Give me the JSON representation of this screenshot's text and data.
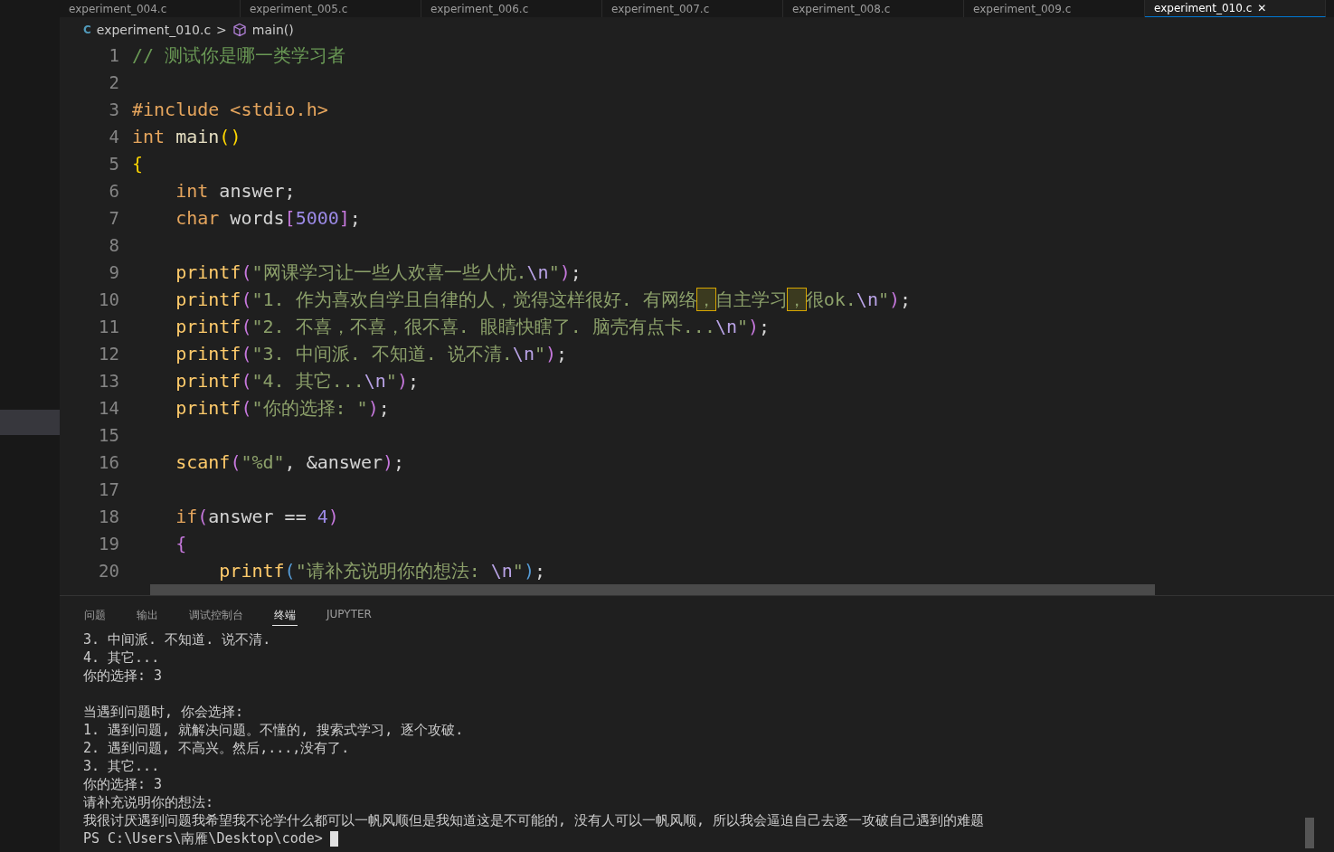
{
  "tabs": [
    {
      "label": "experiment_004.c",
      "selected": false
    },
    {
      "label": "experiment_005.c",
      "selected": false
    },
    {
      "label": "experiment_006.c",
      "selected": false
    },
    {
      "label": "experiment_007.c",
      "selected": false
    },
    {
      "label": "experiment_008.c",
      "selected": false
    },
    {
      "label": "experiment_009.c",
      "selected": false
    },
    {
      "label": "experiment_010.c",
      "selected": true,
      "close": "✕"
    }
  ],
  "breadcrumb": {
    "file_icon": "C",
    "file": "experiment_010.c",
    "separator": ">",
    "symbol": "main()"
  },
  "code_lines": [
    {
      "number": "1",
      "tokens": [
        {
          "kind": "comment",
          "text": "// 测试你是哪一类学习者"
        }
      ]
    },
    {
      "number": "2"
    },
    {
      "number": "3",
      "tokens": [
        {
          "kind": "pre",
          "text": "#include <stdio.h>"
        }
      ]
    },
    {
      "number": "4",
      "tokens": [
        {
          "kind": "type",
          "text": "int"
        },
        {
          "kind": "name",
          "text": " main"
        },
        {
          "kind": "brace",
          "text": "()"
        }
      ]
    },
    {
      "number": "5",
      "tokens": [
        {
          "kind": "brace",
          "text": "{"
        }
      ]
    },
    {
      "number": "6",
      "tokens": [
        {
          "kind": "type",
          "text": "    int"
        },
        {
          "kind": "plain",
          "text": " answer;"
        }
      ]
    },
    {
      "number": "7",
      "tokens": [
        {
          "kind": "type",
          "text": "    char"
        },
        {
          "kind": "plain",
          "text": " words"
        },
        {
          "kind": "paren",
          "text": "["
        },
        {
          "kind": "num",
          "text": "5000"
        },
        {
          "kind": "paren",
          "text": "]"
        },
        {
          "kind": "plain",
          "text": ";"
        }
      ]
    },
    {
      "number": "8"
    },
    {
      "number": "9",
      "tokens": [
        {
          "kind": "func",
          "text": "    printf"
        },
        {
          "kind": "paren",
          "text": "("
        },
        {
          "kind": "string",
          "text": "\"网课学习让一些人欢喜一些人忧."
        },
        {
          "kind": "escape",
          "text": "\\n"
        },
        {
          "kind": "string",
          "text": "\""
        },
        {
          "kind": "paren",
          "text": ")"
        },
        {
          "kind": "plain",
          "text": ";"
        }
      ]
    },
    {
      "number": "10",
      "tokens": [
        {
          "kind": "func",
          "text": "    printf"
        },
        {
          "kind": "paren",
          "text": "("
        },
        {
          "kind": "string",
          "text": "\"1. 作为喜欢自学且自律的人，觉得这样很好. 有网络"
        },
        {
          "kind": "highlight",
          "text": "，"
        },
        {
          "kind": "string",
          "text": "自主学习"
        },
        {
          "kind": "highlight",
          "text": "，"
        },
        {
          "kind": "string",
          "text": "很ok."
        },
        {
          "kind": "escape",
          "text": "\\n"
        },
        {
          "kind": "string",
          "text": "\""
        },
        {
          "kind": "paren",
          "text": ")"
        },
        {
          "kind": "plain",
          "text": ";"
        }
      ]
    },
    {
      "number": "11",
      "tokens": [
        {
          "kind": "func",
          "text": "    printf"
        },
        {
          "kind": "paren",
          "text": "("
        },
        {
          "kind": "string",
          "text": "\"2. 不喜，不喜，很不喜. 眼睛快瞎了. 脑壳有点卡..."
        },
        {
          "kind": "escape",
          "text": "\\n"
        },
        {
          "kind": "string",
          "text": "\""
        },
        {
          "kind": "paren",
          "text": ")"
        },
        {
          "kind": "plain",
          "text": ";"
        }
      ]
    },
    {
      "number": "12",
      "tokens": [
        {
          "kind": "func",
          "text": "    printf"
        },
        {
          "kind": "paren",
          "text": "("
        },
        {
          "kind": "string",
          "text": "\"3. 中间派. 不知道. 说不清."
        },
        {
          "kind": "escape",
          "text": "\\n"
        },
        {
          "kind": "string",
          "text": "\""
        },
        {
          "kind": "paren",
          "text": ")"
        },
        {
          "kind": "plain",
          "text": ";"
        }
      ]
    },
    {
      "number": "13",
      "tokens": [
        {
          "kind": "func",
          "text": "    printf"
        },
        {
          "kind": "paren",
          "text": "("
        },
        {
          "kind": "string",
          "text": "\"4. 其它..."
        },
        {
          "kind": "escape",
          "text": "\\n"
        },
        {
          "kind": "string",
          "text": "\""
        },
        {
          "kind": "paren",
          "text": ")"
        },
        {
          "kind": "plain",
          "text": ";"
        }
      ]
    },
    {
      "number": "14",
      "tokens": [
        {
          "kind": "func",
          "text": "    printf"
        },
        {
          "kind": "paren",
          "text": "("
        },
        {
          "kind": "string",
          "text": "\"你的选择: \""
        },
        {
          "kind": "paren",
          "text": ")"
        },
        {
          "kind": "plain",
          "text": ";"
        }
      ]
    },
    {
      "number": "15"
    },
    {
      "number": "16",
      "tokens": [
        {
          "kind": "func",
          "text": "    scanf"
        },
        {
          "kind": "paren",
          "text": "("
        },
        {
          "kind": "string",
          "text": "\"%d\""
        },
        {
          "kind": "plain",
          "text": ", &answer"
        },
        {
          "kind": "paren",
          "text": ")"
        },
        {
          "kind": "plain",
          "text": ";"
        }
      ]
    },
    {
      "number": "17"
    },
    {
      "number": "18",
      "tokens": [
        {
          "kind": "keyword",
          "text": "    if"
        },
        {
          "kind": "paren",
          "text": "("
        },
        {
          "kind": "plain",
          "text": "answer == "
        },
        {
          "kind": "num",
          "text": "4"
        },
        {
          "kind": "paren",
          "text": ")"
        }
      ]
    },
    {
      "number": "19",
      "tokens": [
        {
          "kind": "paren",
          "text": "    {"
        }
      ]
    },
    {
      "number": "20",
      "tokens": [
        {
          "kind": "func",
          "text": "        printf"
        },
        {
          "kind": "brace2",
          "text": "("
        },
        {
          "kind": "string",
          "text": "\"请补充说明你的想法: "
        },
        {
          "kind": "escape",
          "text": "\\n"
        },
        {
          "kind": "string",
          "text": "\""
        },
        {
          "kind": "brace2",
          "text": ")"
        },
        {
          "kind": "plain",
          "text": ";"
        }
      ]
    }
  ],
  "panel_tabs": [
    {
      "label": "问题",
      "selected": false
    },
    {
      "label": "输出",
      "selected": false
    },
    {
      "label": "调试控制台",
      "selected": false
    },
    {
      "label": "终端",
      "selected": true
    },
    {
      "label": "JUPYTER",
      "selected": false
    }
  ],
  "terminal_blocks": [
    [
      "3. 中间派. 不知道. 说不清.",
      "4. 其它...",
      "你的选择: 3"
    ],
    [
      "当遇到问题时, 你会选择:",
      "1. 遇到问题, 就解决问题。不懂的, 搜索式学习, 逐个攻破.",
      "2. 遇到问题, 不高兴。然后,...,没有了.",
      "3. 其它...",
      "你的选择: 3",
      "请补充说明你的想法:",
      "我很讨厌遇到问题我希望我不论学什么都可以一帆风顺但是我知道这是不可能的, 没有人可以一帆风顺, 所以我会逼迫自己去逐一攻破自己遇到的难题"
    ]
  ],
  "prompt": "PS C:\\Users\\南雁\\Desktop\\code>"
}
